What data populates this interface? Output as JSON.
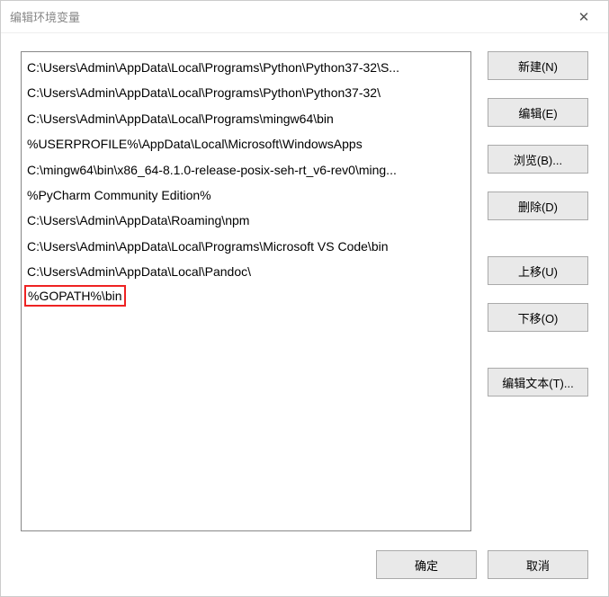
{
  "titlebar": {
    "title": "编辑环境变量"
  },
  "list": {
    "items": [
      "C:\\Users\\Admin\\AppData\\Local\\Programs\\Python\\Python37-32\\S...",
      "C:\\Users\\Admin\\AppData\\Local\\Programs\\Python\\Python37-32\\",
      "C:\\Users\\Admin\\AppData\\Local\\Programs\\mingw64\\bin",
      "%USERPROFILE%\\AppData\\Local\\Microsoft\\WindowsApps",
      "C:\\mingw64\\bin\\x86_64-8.1.0-release-posix-seh-rt_v6-rev0\\ming...",
      "%PyCharm Community Edition%",
      "C:\\Users\\Admin\\AppData\\Roaming\\npm",
      "C:\\Users\\Admin\\AppData\\Local\\Programs\\Microsoft VS Code\\bin",
      "C:\\Users\\Admin\\AppData\\Local\\Pandoc\\",
      "%GOPATH%\\bin"
    ],
    "highlighted_index": 9
  },
  "side_buttons": {
    "new": "新建(N)",
    "edit": "编辑(E)",
    "browse": "浏览(B)...",
    "delete": "删除(D)",
    "move_up": "上移(U)",
    "move_down": "下移(O)",
    "edit_text": "编辑文本(T)..."
  },
  "footer": {
    "ok": "确定",
    "cancel": "取消"
  }
}
